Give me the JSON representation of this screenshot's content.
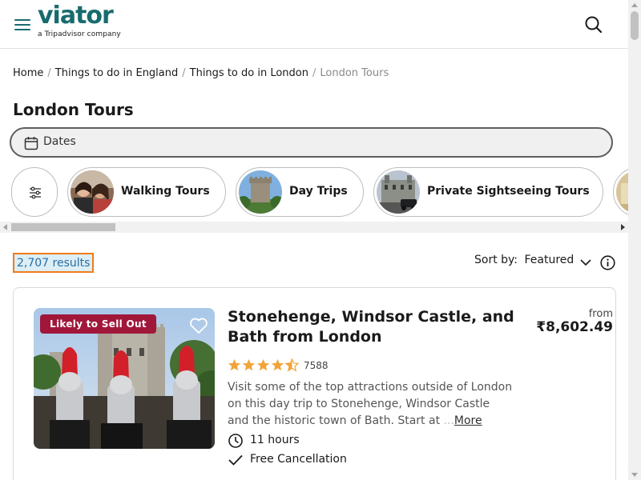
{
  "header": {
    "logo": "viator",
    "logo_sub": "a Tripadvisor company",
    "brand_color": "#186b6d",
    "menu_icon": "hamburger-menu-icon",
    "search_icon": "search-icon"
  },
  "breadcrumb": {
    "items": [
      "Home",
      "Things to do in England",
      "Things to do in London"
    ],
    "current": "London Tours",
    "separator": "/"
  },
  "page_title": "London Tours",
  "dates_field": {
    "label": "Dates",
    "icon": "calendar-icon"
  },
  "categories": [
    {
      "label": "Walking Tours"
    },
    {
      "label": "Day Trips"
    },
    {
      "label": "Private Sightseeing Tours"
    }
  ],
  "results": {
    "count_text": "2,707 results",
    "sort_label": "Sort by:",
    "sort_value": "Featured"
  },
  "card": {
    "badge": "Likely to Sell Out",
    "badge_color": "#a1173a",
    "title": "Stonehenge, Windsor Castle, and Bath from London",
    "rating": 4.5,
    "review_count": "7588",
    "star_color": "#f2a43a",
    "description": "Visit some of the top attractions outside of London on this day trip to Stonehenge, Windsor Castle and the historic town of Bath. Start at",
    "description_trail": "...",
    "more_label": "More",
    "duration": "11 hours",
    "cancellation": "Free Cancellation",
    "from_label": "from",
    "price": "₹8,602.49"
  },
  "highlight_color": "#f07c1b"
}
